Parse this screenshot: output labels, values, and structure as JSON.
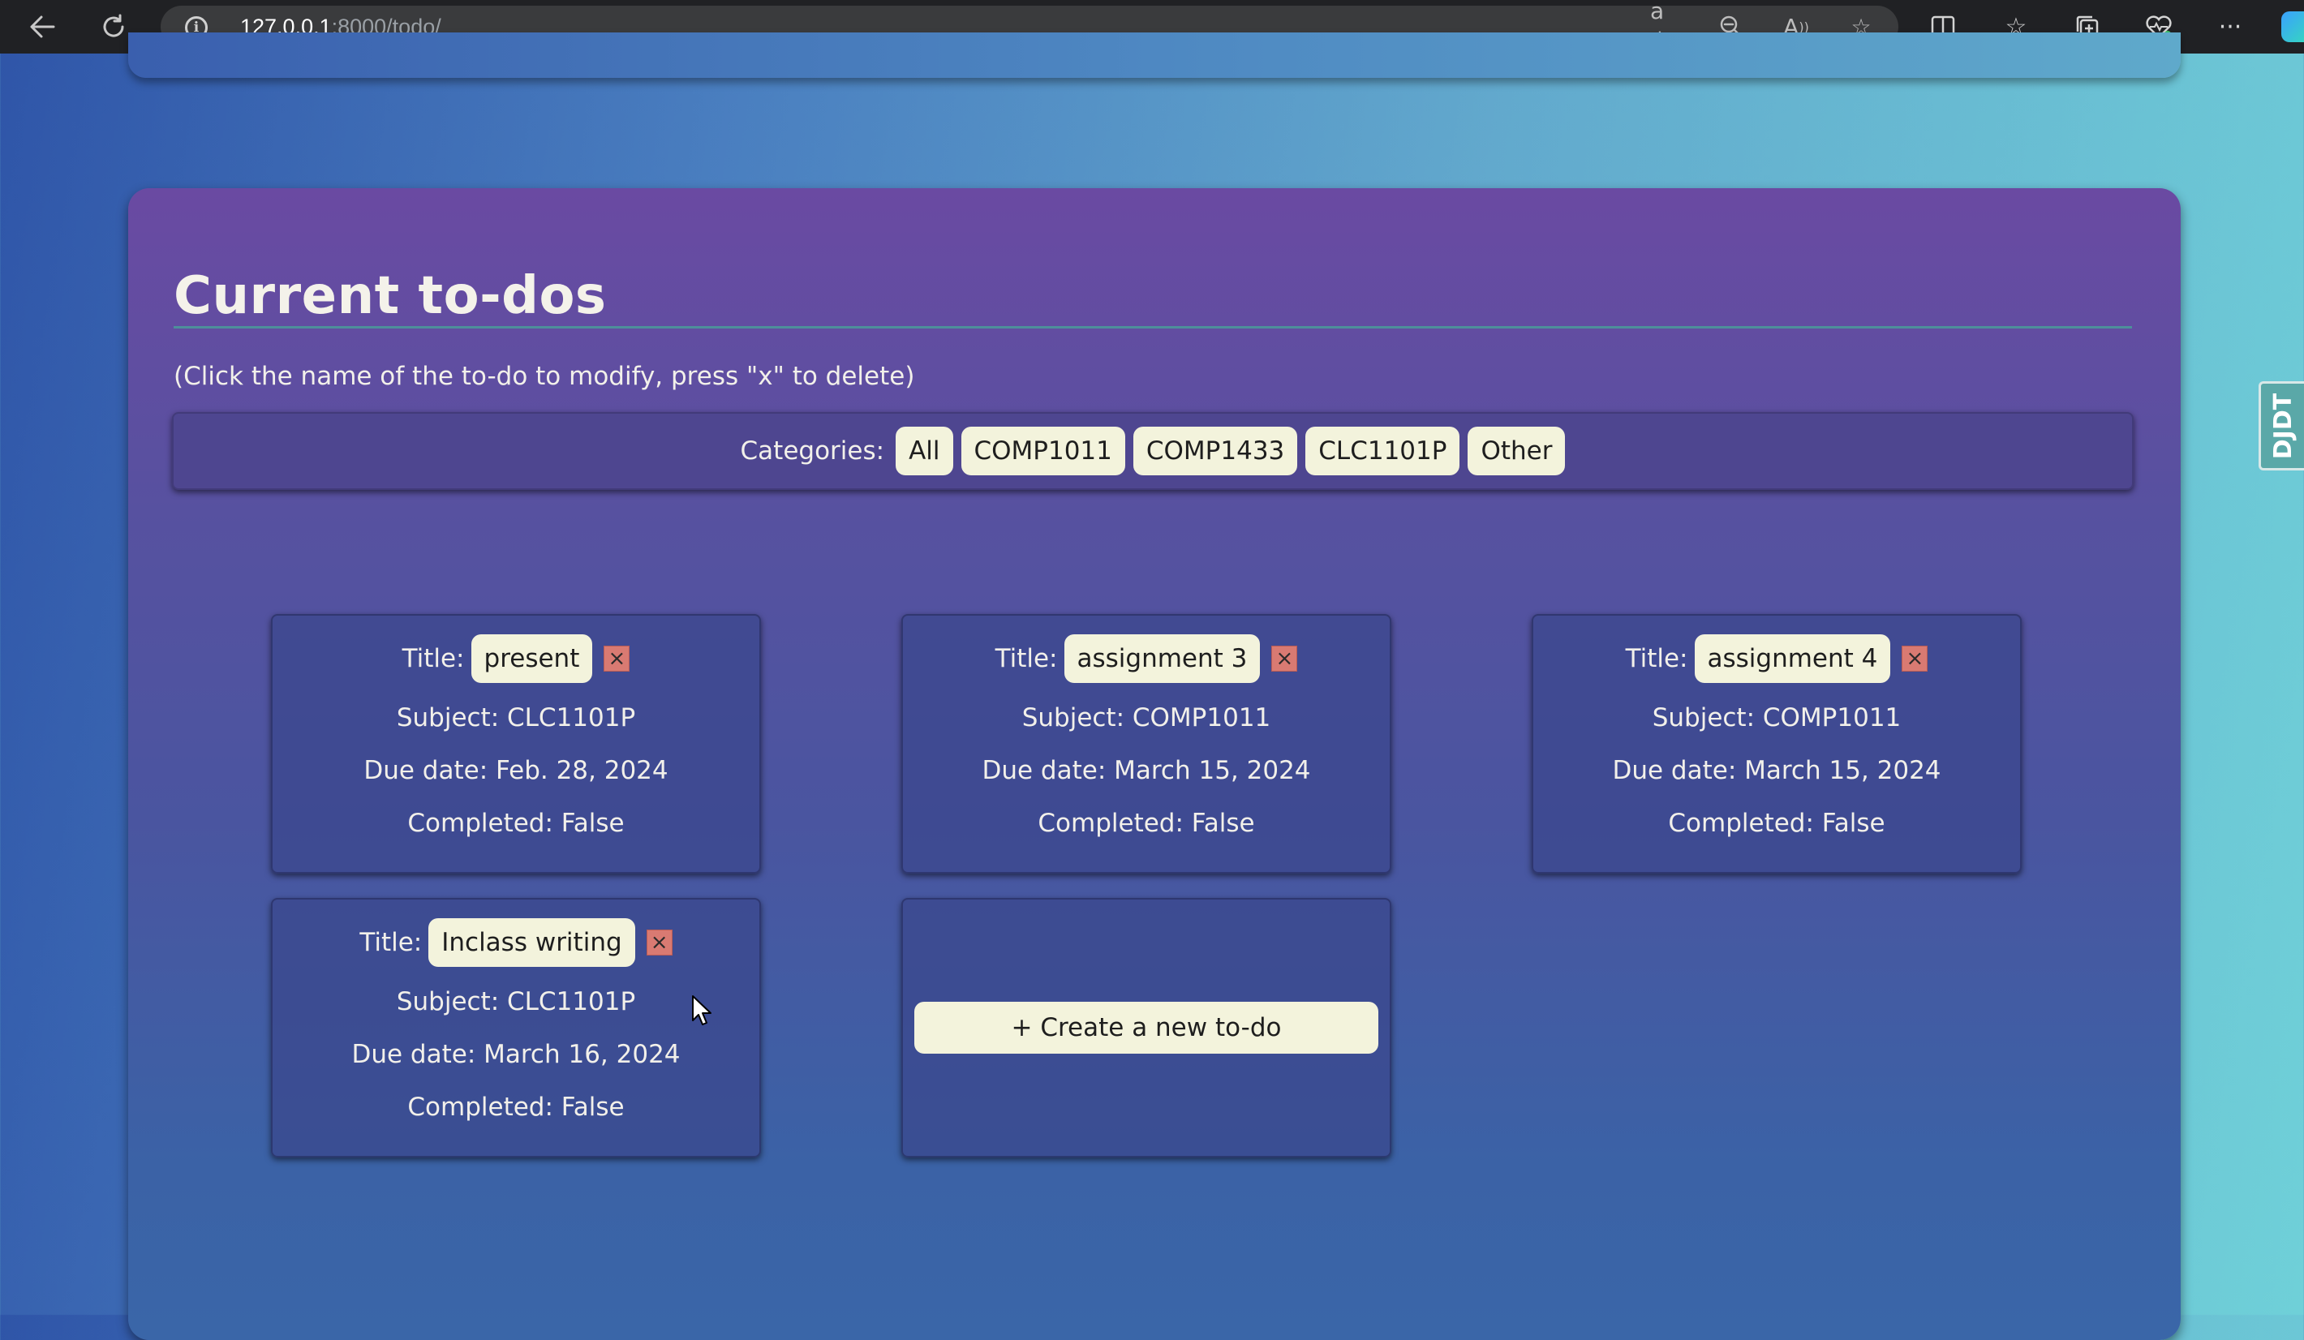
{
  "browser": {
    "url_host": "127.0.0.1",
    "url_rest": ":8000/todo/",
    "icons": [
      "back-arrow-icon",
      "refresh-icon",
      "site-info-icon",
      "translate-icon",
      "zoom-out-icon",
      "read-aloud-icon",
      "favorite-star-icon",
      "split-screen-icon",
      "favorites-icon",
      "collections-icon",
      "browser-essentials-icon",
      "more-icon",
      "copilot-icon"
    ]
  },
  "page": {
    "title": "Current to-dos",
    "instructions": "(Click the name of the to-do to modify, press \"x\" to delete)",
    "categories_label": "Categories:",
    "categories": [
      "All",
      "COMP1011",
      "COMP1433",
      "CLC1101P",
      "Other"
    ],
    "title_prefix": "Title:",
    "delete_symbol": "×",
    "todos": [
      {
        "title": "present",
        "subject": "Subject: CLC1101P",
        "due": "Due date: Feb. 28, 2024",
        "completed": "Completed: False"
      },
      {
        "title": "assignment 3",
        "subject": "Subject: COMP1011",
        "due": "Due date: March 15, 2024",
        "completed": "Completed: False"
      },
      {
        "title": "assignment 4",
        "subject": "Subject: COMP1011",
        "due": "Due date: March 15, 2024",
        "completed": "Completed: False"
      },
      {
        "title": "Inclass writing",
        "subject": "Subject: CLC1101P",
        "due": "Due date: March 16, 2024",
        "completed": "Completed: False"
      }
    ],
    "create_label": "+ Create a new to-do",
    "side_tab_label": "DJDT"
  },
  "colors": {
    "card_bg_top": "#6a4aa2",
    "button_bg": "#f3f3dc",
    "delete_bg": "#d97a72",
    "rule": "#4d8f9a"
  }
}
